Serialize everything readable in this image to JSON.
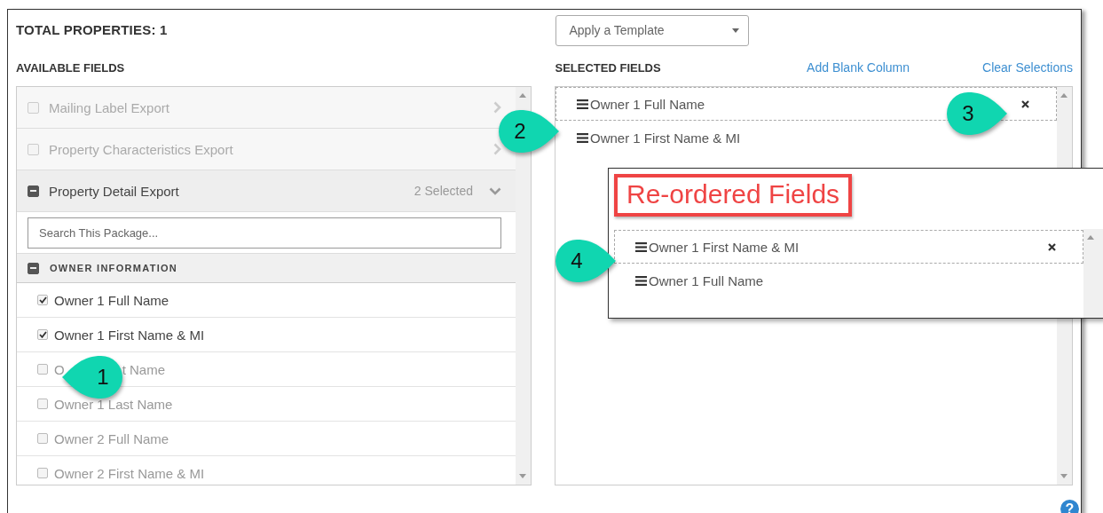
{
  "header": {
    "total_properties": "TOTAL PROPERTIES: 1"
  },
  "template_dropdown": {
    "value": "Apply a Template"
  },
  "available_fields": {
    "title": "AVAILABLE FIELDS",
    "packages": [
      {
        "label": "Mailing Label Export",
        "expanded": false
      },
      {
        "label": "Property Characteristics Export",
        "expanded": false
      },
      {
        "label": "Property Detail Export",
        "expanded": true,
        "count": "2 Selected"
      }
    ],
    "search": {
      "placeholder": "Search This Package..."
    },
    "group": {
      "label": "OWNER INFORMATION",
      "expanded": true
    },
    "fields": [
      {
        "label": "Owner 1 Full Name",
        "checked": true
      },
      {
        "label": "Owner 1 First Name & MI",
        "checked": true
      },
      {
        "label": "O",
        "label_end": "t Name",
        "checked": false
      },
      {
        "label": "Owner 1 Last Name",
        "checked": false
      },
      {
        "label": "Owner 2 Full Name",
        "checked": false
      },
      {
        "label": "Owner 2 First Name & MI",
        "checked": false
      }
    ]
  },
  "selected_fields": {
    "title": "SELECTED FIELDS",
    "links": [
      "Add Blank Column",
      "Clear Selections"
    ],
    "items": [
      {
        "label": "Owner 1 Full Name",
        "hovered": true
      },
      {
        "label": "Owner 1 First Name & MI",
        "hovered": false
      }
    ]
  },
  "reordered_panel": {
    "title": "Re-ordered Fields",
    "items": [
      {
        "label": "Owner 1 First Name & MI",
        "hovered": true
      },
      {
        "label": "Owner 1 Full Name",
        "hovered": false
      }
    ]
  },
  "callouts": [
    {
      "number": "1",
      "kind": "left"
    },
    {
      "number": "2",
      "kind": "right"
    },
    {
      "number": "3",
      "kind": "right"
    },
    {
      "number": "4",
      "kind": "right"
    }
  ],
  "help_icon": "?"
}
